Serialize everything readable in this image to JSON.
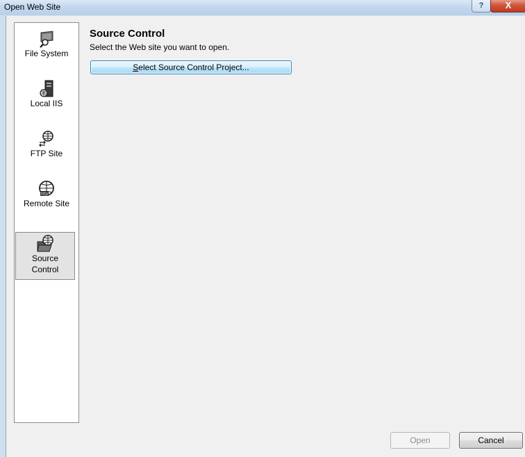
{
  "window": {
    "title": "Open Web Site",
    "help_label": "?",
    "close_label": "X"
  },
  "sidebar": {
    "items": [
      {
        "label": "File System",
        "icon": "file-system-icon"
      },
      {
        "label": "Local IIS",
        "icon": "local-iis-icon"
      },
      {
        "label": "FTP Site",
        "icon": "ftp-site-icon"
      },
      {
        "label": "Remote Site",
        "icon": "remote-site-icon"
      },
      {
        "label_line1": "Source",
        "label_line2": "Control",
        "icon": "source-control-icon",
        "selected": true
      }
    ]
  },
  "main": {
    "heading": "Source Control",
    "description": "Select the Web site you want to open.",
    "select_button": {
      "mnemonic": "S",
      "rest": "elect Source Control Project..."
    }
  },
  "footer": {
    "open_label": "Open",
    "cancel_label": "Cancel"
  },
  "colors": {
    "accent": "#3c7fb1",
    "close": "#c03a22",
    "titlebar": "#c3d6ec"
  }
}
